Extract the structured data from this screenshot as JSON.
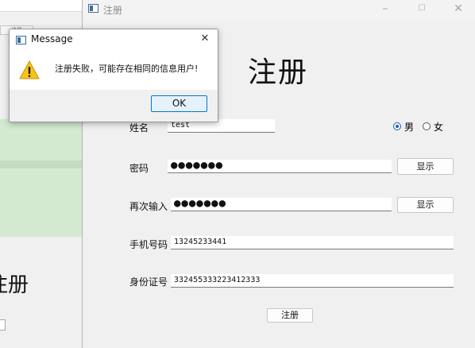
{
  "background_window": {
    "tab_label": "注册",
    "heading": "注册"
  },
  "main_window": {
    "title": "注册",
    "controls": {
      "minimize": "–",
      "maximize": "☐",
      "close": "✕"
    },
    "heading": "注册",
    "name_label": "姓名",
    "name_value": "test",
    "gender_options": [
      {
        "label": "男",
        "checked": true
      },
      {
        "label": "女",
        "checked": false
      }
    ],
    "password_label": "密码",
    "password_value": "●●●●●●●",
    "password_show_button": "显示",
    "confirm_label": "再次输入",
    "confirm_value": "●●●●●●●",
    "confirm_show_button": "显示",
    "phone_label": "手机号码",
    "phone_value": "13245233441",
    "id_label": "身份证号",
    "id_value": "332455333223412333",
    "submit_button": "注册"
  },
  "dialog": {
    "title": "Message",
    "close": "✕",
    "icon": "warning-icon",
    "message": "注册失败，可能存在相同的信息用户!",
    "ok_button": "OK"
  }
}
